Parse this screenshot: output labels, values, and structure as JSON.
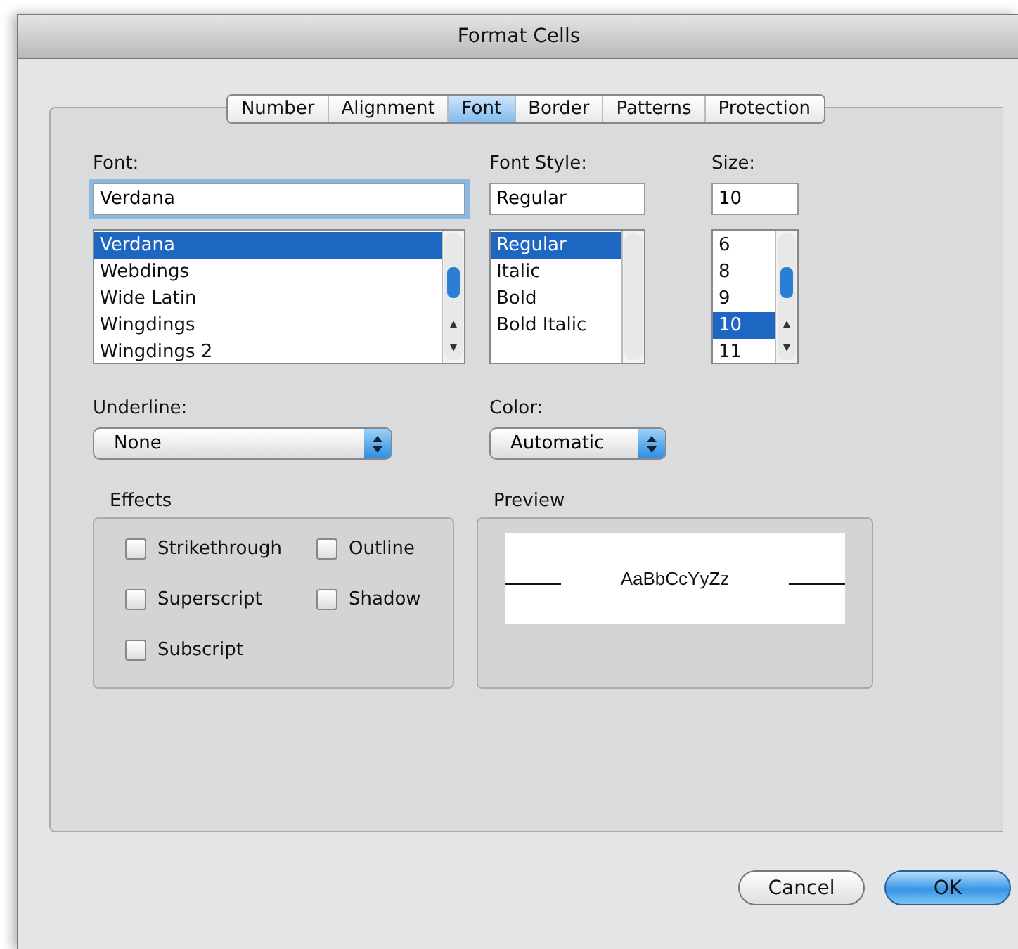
{
  "window": {
    "title": "Format Cells"
  },
  "tabs": [
    {
      "label": "Number",
      "selected": false
    },
    {
      "label": "Alignment",
      "selected": false
    },
    {
      "label": "Font",
      "selected": true
    },
    {
      "label": "Border",
      "selected": false
    },
    {
      "label": "Patterns",
      "selected": false
    },
    {
      "label": "Protection",
      "selected": false
    }
  ],
  "font": {
    "label": "Font:",
    "value": "Verdana",
    "options": [
      {
        "label": "Verdana",
        "selected": true
      },
      {
        "label": "Webdings",
        "selected": false
      },
      {
        "label": "Wide Latin",
        "selected": false
      },
      {
        "label": "Wingdings",
        "selected": false
      },
      {
        "label": "Wingdings 2",
        "selected": false
      }
    ]
  },
  "font_style": {
    "label": "Font Style:",
    "value": "Regular",
    "options": [
      {
        "label": "Regular",
        "selected": true
      },
      {
        "label": "Italic",
        "selected": false
      },
      {
        "label": "Bold",
        "selected": false
      },
      {
        "label": "Bold Italic",
        "selected": false
      }
    ]
  },
  "size": {
    "label": "Size:",
    "value": "10",
    "options": [
      {
        "label": "6",
        "selected": false
      },
      {
        "label": "8",
        "selected": false
      },
      {
        "label": "9",
        "selected": false
      },
      {
        "label": "10",
        "selected": true
      },
      {
        "label": "11",
        "selected": false
      }
    ]
  },
  "underline": {
    "label": "Underline:",
    "value": "None"
  },
  "color": {
    "label": "Color:",
    "value": "Automatic"
  },
  "effects": {
    "label": "Effects",
    "options": [
      {
        "label": "Strikethrough",
        "checked": false
      },
      {
        "label": "Outline",
        "checked": false
      },
      {
        "label": "Superscript",
        "checked": false
      },
      {
        "label": "Shadow",
        "checked": false
      },
      {
        "label": "Subscript",
        "checked": false
      }
    ]
  },
  "preview": {
    "label": "Preview",
    "sample": "AaBbCcYyZz"
  },
  "buttons": [
    {
      "label": "Cancel",
      "kind": "normal"
    },
    {
      "label": "OK",
      "kind": "default"
    }
  ]
}
